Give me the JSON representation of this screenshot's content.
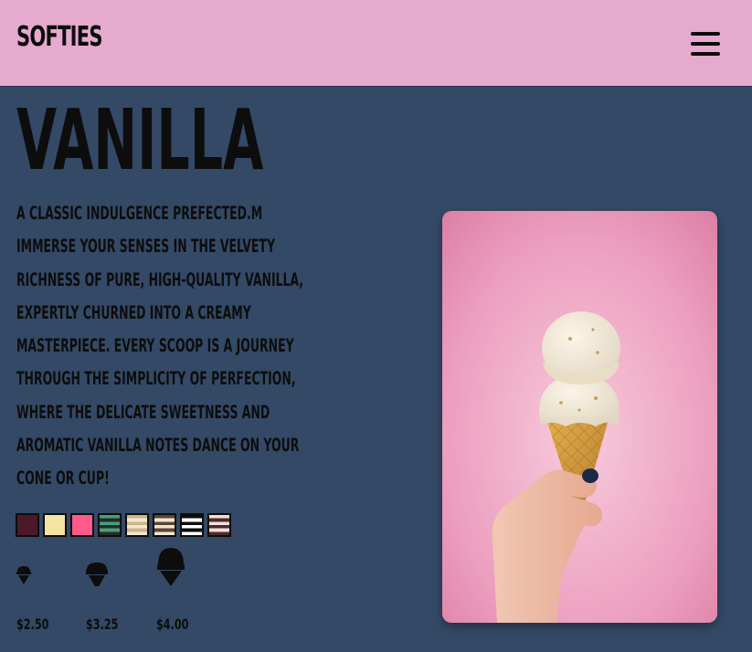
{
  "brand": "SOFTIES",
  "nav": {
    "menu_icon": "hamburger-menu-icon"
  },
  "flavor": {
    "title": "VANILLA",
    "description": "A CLASSIC INDULGENCE PREFECTED.M IMMERSE YOUR SENSES IN THE VELVETY RICHNESS OF PURE, HIGH-QUALITY VANILLA, EXPERTLY CHURNED INTO A CREAMY MASTERPIECE. EVERY SCOOP IS A JOURNEY THROUGH THE SIMPLICITY OF PERFECTION, WHERE THE DELICATE SWEETNESS AND AROMATIC VANILLA NOTES DANCE ON YOUR CONE OR CUP!"
  },
  "swatches": [
    {
      "name": "burgundy",
      "color": "#4a1a2c",
      "stripes": null
    },
    {
      "name": "cream",
      "color": "#f4e4a4",
      "stripes": null
    },
    {
      "name": "pink",
      "color": "#ff5a8a",
      "stripes": null
    },
    {
      "name": "mint-stripes",
      "color": "#44a37a",
      "stripes": "#2a2a2a"
    },
    {
      "name": "tan-stripes",
      "color": "#cdb48a",
      "stripes": "#f2e7cf"
    },
    {
      "name": "brown-stripes",
      "color": "#5b4632",
      "stripes": "#f1e6d3"
    },
    {
      "name": "black-stripes",
      "color": "#0d0d0d",
      "stripes": "#ffffff"
    },
    {
      "name": "cream-brown-stripes",
      "color": "#f4dedd",
      "stripes": "#4a2c2a"
    }
  ],
  "sizes": [
    {
      "label": "small",
      "price": "$2.50",
      "icon": "small-cone-icon"
    },
    {
      "label": "medium",
      "price": "$3.25",
      "icon": "medium-cone-icon"
    },
    {
      "label": "large",
      "price": "$4.00",
      "icon": "large-cone-icon"
    }
  ],
  "photo": {
    "alt": "hand holding a vanilla ice cream cone against a pink background"
  },
  "colors": {
    "header_bg": "#e6aace",
    "page_bg": "#344966",
    "text": "#0d0d0d"
  }
}
